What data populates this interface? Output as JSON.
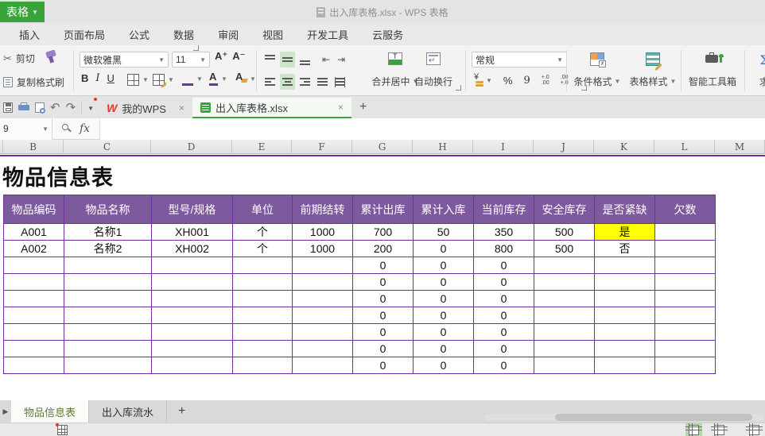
{
  "window": {
    "app_button": "表格",
    "title": "出入库表格.xlsx - WPS 表格"
  },
  "menu": {
    "items": [
      "插入",
      "页面布局",
      "公式",
      "数据",
      "审阅",
      "视图",
      "开发工具",
      "云服务"
    ]
  },
  "ribbon": {
    "clipboard": {
      "cut": "剪切",
      "copy": "复制",
      "format_painter": "格式刷"
    },
    "font": {
      "family": "微软雅黑",
      "size": "11",
      "grow": "A⁺",
      "shrink": "A⁻",
      "bold": "B",
      "italic": "I",
      "underline": "U"
    },
    "align": {
      "merge_center": "合并居中",
      "wrap_text": "自动换行"
    },
    "number": {
      "format": "常规",
      "percent": "%",
      "comma": "9",
      "inc_decimal": "+.0|.00",
      "dec_decimal": ".00|+.0",
      "currency": "¥"
    },
    "big": {
      "conditional_format": "条件格式",
      "table_style": "表格样式",
      "smart_toolbox": "智能工具箱",
      "partial_right": "求"
    }
  },
  "doc_tabs": {
    "my_wps": "我的WPS",
    "document": "出入库表格.xlsx",
    "close": "×",
    "add": "+"
  },
  "formula_bar": {
    "name_box": "9",
    "fx_label": "fx",
    "formula": ""
  },
  "sheet": {
    "columns": [
      "B",
      "C",
      "D",
      "E",
      "F",
      "G",
      "H",
      "I",
      "J",
      "K",
      "L",
      "M"
    ],
    "title": "物品信息表",
    "table": {
      "headers": [
        "物品编码",
        "物品名称",
        "型号/规格",
        "单位",
        "前期结转",
        "累计出库",
        "累计入库",
        "当前库存",
        "安全库存",
        "是否紧缺",
        "欠数"
      ],
      "rows": [
        [
          "A001",
          "名称1",
          "XH001",
          "个",
          "1000",
          "700",
          "50",
          "350",
          "500",
          "是",
          ""
        ],
        [
          "A002",
          "名称2",
          "XH002",
          "个",
          "1000",
          "200",
          "0",
          "800",
          "500",
          "否",
          ""
        ],
        [
          "",
          "",
          "",
          "",
          "",
          "0",
          "0",
          "0",
          "",
          "",
          ""
        ],
        [
          "",
          "",
          "",
          "",
          "",
          "0",
          "0",
          "0",
          "",
          "",
          ""
        ],
        [
          "",
          "",
          "",
          "",
          "",
          "0",
          "0",
          "0",
          "",
          "",
          ""
        ],
        [
          "",
          "",
          "",
          "",
          "",
          "0",
          "0",
          "0",
          "",
          "",
          ""
        ],
        [
          "",
          "",
          "",
          "",
          "",
          "0",
          "0",
          "0",
          "",
          "",
          ""
        ],
        [
          "",
          "",
          "",
          "",
          "",
          "0",
          "0",
          "0",
          "",
          "",
          ""
        ],
        [
          "",
          "",
          "",
          "",
          "",
          "0",
          "0",
          "0",
          "",
          "",
          ""
        ]
      ],
      "highlight": {
        "row": 0,
        "col": 9,
        "color": "#ffff00"
      }
    }
  },
  "sheet_tabs": {
    "tabs": [
      "物品信息表",
      "出入库流水"
    ],
    "active_index": 0,
    "add": "+"
  },
  "colors": {
    "accent_green": "#3aa33b",
    "table_header_purple": "#7d5a9e",
    "table_border_purple": "#7030a0",
    "highlight_yellow": "#ffff00",
    "active_sheet_text": "#5c7a3a"
  }
}
